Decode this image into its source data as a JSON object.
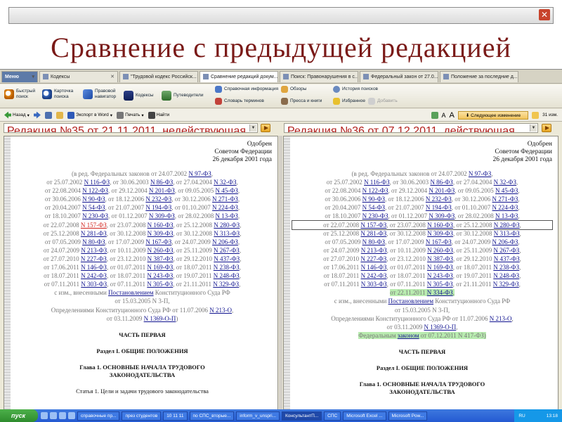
{
  "slide_title": "Сравнение с предыдущей редакцией",
  "tabs": [
    {
      "label": "Меню",
      "close": "▾"
    },
    {
      "label": "Кодексы",
      "close": "✕"
    },
    {
      "label": "\"Трудовой кодекс Российск...",
      "close": "✕"
    },
    {
      "label": "Сравнение редакций докум...",
      "close": "✕"
    },
    {
      "label": "Поиск: Правонарушения в с...",
      "close": "✕"
    },
    {
      "label": "Федеральный закон от 27.0...",
      "close": "✕"
    },
    {
      "label": "Положение за последние д...",
      "close": "✕"
    }
  ],
  "ribbon": {
    "quick_search": "Быстрый поиск",
    "search_card": "Карточка поиска",
    "navigator": "Правовой навигатор",
    "codes": "Кодексы",
    "guides": "Путеводители",
    "reference": "Справочная информация",
    "reviews": "Обзоры",
    "search_history": "История поисков",
    "dictionary": "Словарь терминов",
    "press": "Пресса и книги",
    "favorites": "Избранное",
    "add": "Добавить"
  },
  "navbar": {
    "back": "Назад",
    "export_word": "Экспорт в Word",
    "print": "Печать",
    "find": "Найти",
    "next_change": "Следующее изменение",
    "changes_count": "31 изм."
  },
  "left_redaction": "Редакция №35 от 21.11.2011, недействующая",
  "right_redaction": "Редакция №36 от 07.12.2011, действующая",
  "approval": [
    "Одобрен",
    "Советом Федерации",
    "26 декабря 2001 года"
  ],
  "amend_lines": [
    [
      {
        "t": "(в ред. Федеральных законов от 24.07.2002 "
      },
      {
        "t": "N 97-ФЗ",
        "link": true
      },
      {
        "t": ","
      }
    ],
    [
      {
        "t": "от 25.07.2002 "
      },
      {
        "t": "N 116-ФЗ",
        "link": true
      },
      {
        "t": ", от 30.06.2003 "
      },
      {
        "t": "N 86-ФЗ",
        "link": true
      },
      {
        "t": ", от 27.04.2004 "
      },
      {
        "t": "N 32-ФЗ",
        "link": true
      },
      {
        "t": ","
      }
    ],
    [
      {
        "t": "от 22.08.2004 "
      },
      {
        "t": "N 122-ФЗ",
        "link": true
      },
      {
        "t": ", от 29.12.2004 "
      },
      {
        "t": "N 201-ФЗ",
        "link": true
      },
      {
        "t": ", от 09.05.2005 "
      },
      {
        "t": "N 45-ФЗ",
        "link": true
      },
      {
        "t": ","
      }
    ],
    [
      {
        "t": "от 30.06.2006 "
      },
      {
        "t": "N 90-ФЗ",
        "link": true
      },
      {
        "t": ", от 18.12.2006 "
      },
      {
        "t": "N 232-ФЗ",
        "link": true
      },
      {
        "t": ", от 30.12.2006 "
      },
      {
        "t": "N 271-ФЗ",
        "link": true
      },
      {
        "t": ","
      }
    ],
    [
      {
        "t": "от 20.04.2007 "
      },
      {
        "t": "N 54-ФЗ",
        "link": true
      },
      {
        "t": ", от 21.07.2007 "
      },
      {
        "t": "N 194-ФЗ",
        "link": true
      },
      {
        "t": ", от 01.10.2007 "
      },
      {
        "t": "N 224-ФЗ",
        "link": true
      },
      {
        "t": ","
      }
    ],
    [
      {
        "t": "от 18.10.2007 "
      },
      {
        "t": "N 230-ФЗ",
        "link": true
      },
      {
        "t": ", от 01.12.2007 "
      },
      {
        "t": "N 309-ФЗ",
        "link": true
      },
      {
        "t": ", от 28.02.2008 "
      },
      {
        "t": "N 13-ФЗ",
        "link": true
      },
      {
        "t": ","
      }
    ],
    [
      {
        "t": "от 22.07.2008 "
      },
      {
        "t": "N 157-ФЗ",
        "link": true,
        "red_left": true
      },
      {
        "t": ", от 23.07.2008 "
      },
      {
        "t": "N 160-ФЗ",
        "link": true
      },
      {
        "t": ", от 25.12.2008 "
      },
      {
        "t": "N 280-ФЗ",
        "link": true
      },
      {
        "t": ","
      }
    ],
    [
      {
        "t": "от 25.12.2008 "
      },
      {
        "t": "N 281-ФЗ",
        "link": true
      },
      {
        "t": ", от 30.12.2008 "
      },
      {
        "t": "N 309-ФЗ",
        "link": true
      },
      {
        "t": ", от 30.12.2008 "
      },
      {
        "t": "N 313-ФЗ",
        "link": true
      },
      {
        "t": ","
      }
    ],
    [
      {
        "t": "от 07.05.2009 "
      },
      {
        "t": "N 80-ФЗ",
        "link": true
      },
      {
        "t": ", от 17.07.2009 "
      },
      {
        "t": "N 167-ФЗ",
        "link": true
      },
      {
        "t": ", от 24.07.2009 "
      },
      {
        "t": "N 206-ФЗ",
        "link": true
      },
      {
        "t": ","
      }
    ],
    [
      {
        "t": "от 24.07.2009 "
      },
      {
        "t": "N 213-ФЗ",
        "link": true
      },
      {
        "t": ", от 10.11.2009 "
      },
      {
        "t": "N 260-ФЗ",
        "link": true
      },
      {
        "t": ", от 25.11.2009 "
      },
      {
        "t": "N 267-ФЗ",
        "link": true
      },
      {
        "t": ","
      }
    ],
    [
      {
        "t": "от 27.07.2010 "
      },
      {
        "t": "N 227-ФЗ",
        "link": true
      },
      {
        "t": ", от 23.12.2010 "
      },
      {
        "t": "N 387-ФЗ",
        "link": true
      },
      {
        "t": ", от 29.12.2010 "
      },
      {
        "t": "N 437-ФЗ",
        "link": true
      },
      {
        "t": ","
      }
    ],
    [
      {
        "t": "от 17.06.2011 "
      },
      {
        "t": "N 146-ФЗ",
        "link": true
      },
      {
        "t": ", от 01.07.2011 "
      },
      {
        "t": "N 169-ФЗ",
        "link": true
      },
      {
        "t": ", от 18.07.2011 "
      },
      {
        "t": "N 238-ФЗ",
        "link": true
      },
      {
        "t": ","
      }
    ],
    [
      {
        "t": "от 18.07.2011 "
      },
      {
        "t": "N 242-ФЗ",
        "link": true
      },
      {
        "t": ", от 18.07.2011 "
      },
      {
        "t": "N 243-ФЗ",
        "link": true
      },
      {
        "t": ", от 19.07.2011 "
      },
      {
        "t": "N 248-ФЗ",
        "link": true
      },
      {
        "t": ","
      }
    ]
  ],
  "left_line_14": [
    {
      "t": "от 07.11.2011 "
    },
    {
      "t": "N 303-ФЗ",
      "link": true
    },
    {
      "t": ", от 07.11.2011 "
    },
    {
      "t": "N 305-ФЗ",
      "link": true
    },
    {
      "t": ", от 21.11.2011 "
    },
    {
      "t": "N 329-ФЗ",
      "link": true
    },
    {
      "t": ","
    }
  ],
  "right_line_14": [
    {
      "t": "от 07.11.2011 "
    },
    {
      "t": "N 303-ФЗ",
      "link": true
    },
    {
      "t": ", от 07.11.2011 "
    },
    {
      "t": "N 305-ФЗ",
      "link": true
    },
    {
      "t": ", от 21.11.2011 "
    },
    {
      "t": "N 329-ФЗ",
      "link": true
    },
    {
      "t": ","
    }
  ],
  "right_inserted_line": [
    {
      "t": "от 22.11.2011 "
    },
    {
      "t": "N 334-ФЗ",
      "link": true
    },
    {
      "t": ","
    }
  ],
  "tail_lines": [
    [
      {
        "t": "с изм., внесенными "
      },
      {
        "t": "Постановлением",
        "link": true
      },
      {
        "t": " Конституционного Суда РФ"
      }
    ],
    [
      {
        "t": "от 15.03.2005 N 3-П,"
      }
    ],
    [
      {
        "t": "Определениями Конституционного Суда РФ от 11.07.2006 "
      },
      {
        "t": "N 213-О",
        "link": true
      },
      {
        "t": ","
      }
    ]
  ],
  "left_last_line": [
    {
      "t": "от 03.11.2009 "
    },
    {
      "t": "N 1369-О-П",
      "link": true
    },
    {
      "t": ")"
    }
  ],
  "right_last_line": [
    {
      "t": "от 03.11.2009 "
    },
    {
      "t": "N 1369-О-П",
      "link": true
    },
    {
      "t": ","
    }
  ],
  "right_added_line": [
    {
      "t": "Федеральным "
    },
    {
      "t": "законом",
      "link": true
    },
    {
      "t": " от 07.12.2011 N 417-ФЗ)"
    }
  ],
  "part_title": "ЧАСТЬ ПЕРВАЯ",
  "section_title": "Раздел I. ОБЩИЕ ПОЛОЖЕНИЯ",
  "chapter_title_1": "Глава 1. ОСНОВНЫЕ НАЧАЛА ТРУДОВОГО",
  "chapter_title_2": "ЗАКОНОДАТЕЛЬСТВА",
  "left_cut_line": "Статья 1. Цели и задачи трудового законодательства",
  "taskbar": {
    "start": "пуск",
    "items": [
      "справочные пр...",
      "през студентов",
      "10 11 11",
      "по СПС_вторые...",
      "inform_v_unspri...",
      "КонсультантП...",
      "СПС",
      "Microsoft Excel ...",
      "Microsoft Pow..."
    ],
    "lang": "RU",
    "clock": "13:18"
  }
}
